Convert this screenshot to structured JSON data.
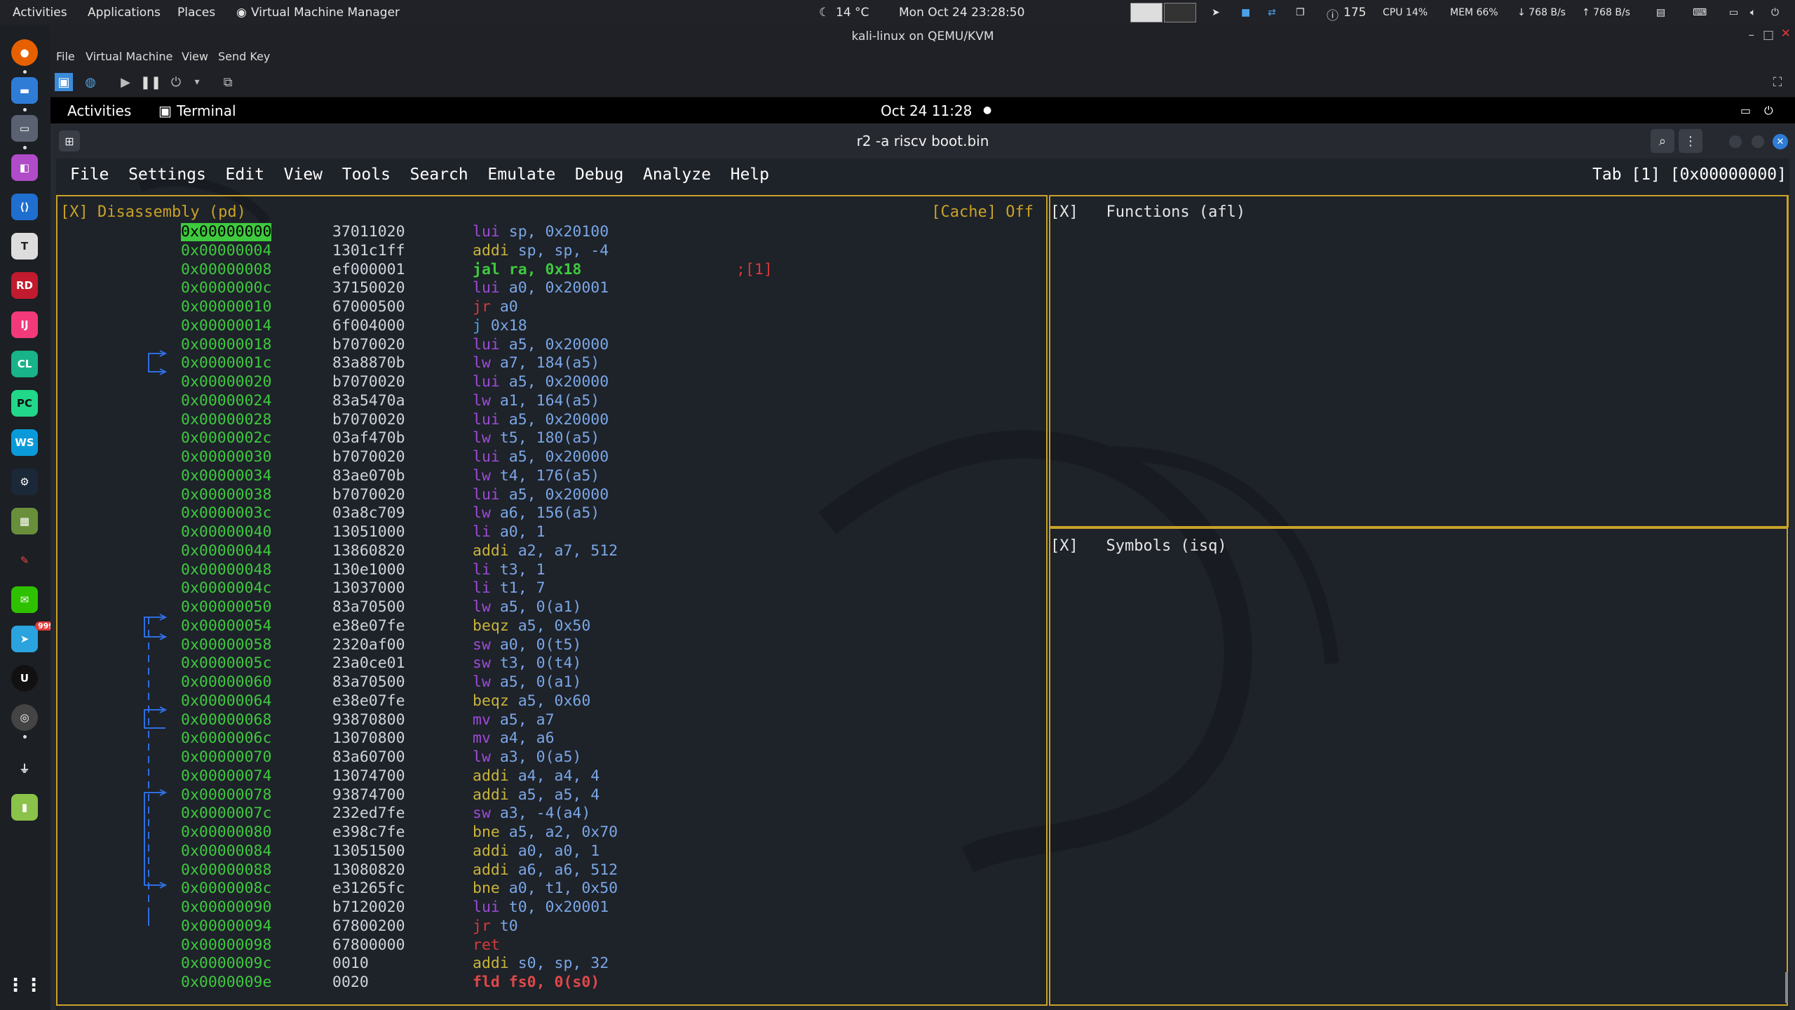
{
  "host_topbar": {
    "activities": "Activities",
    "applications": "Applications",
    "places": "Places",
    "app_name": "Virtual Machine Manager",
    "weather": "14 °C",
    "datetime": "Mon Oct 24  23:28:50",
    "count": "175",
    "cpu": "CPU 14%",
    "mem": "MEM 66%",
    "net_down": "↓ 768 B/s",
    "net_up": "↑ 768 B/s"
  },
  "vm_window": {
    "title": "kali-linux on QEMU/KVM",
    "menu": [
      "File",
      "Virtual Machine",
      "View",
      "Send Key"
    ]
  },
  "guest_topbar": {
    "activities": "Activities",
    "app": "Terminal",
    "clock": "Oct 24  11:28"
  },
  "terminal": {
    "title": "r2 -a riscv boot.bin",
    "menu_line": "File  Settings  Edit  View  Tools  Search  Emulate  Debug  Analyze  Help",
    "tab_info": "Tab [1] [0x00000000]"
  },
  "panels": {
    "disasm_title": "[X] Disassembly (pd)",
    "cache": "[Cache] Off",
    "functions_title": "[X]   Functions (afl)",
    "symbols_title": "[X]   Symbols (isq)"
  },
  "disasm": [
    {
      "addr": "0x00000000",
      "hex": "37011020",
      "mn": "lui",
      "ops": "sp, 0x20100",
      "cls": "mn-purple",
      "hl": true
    },
    {
      "addr": "0x00000004",
      "hex": "1301c1ff",
      "mn": "addi",
      "ops": "sp, sp, -4",
      "cls": "mn-yellow"
    },
    {
      "addr": "0x00000008",
      "hex": "ef000001",
      "mn": "jal",
      "ops": "ra, 0x18",
      "cls": "mn-green",
      "comment": ";[1]"
    },
    {
      "addr": "0x0000000c",
      "hex": "37150020",
      "mn": "lui",
      "ops": "a0, 0x20001",
      "cls": "mn-purple"
    },
    {
      "addr": "0x00000010",
      "hex": "67000500",
      "mn": "jr",
      "ops": "a0",
      "cls": "mn-red"
    },
    {
      "addr": "0x00000014",
      "hex": "6f004000",
      "mn": "j",
      "ops": "0x18",
      "cls": "mn-blue"
    },
    {
      "addr": "0x00000018",
      "hex": "b7070020",
      "mn": "lui",
      "ops": "a5, 0x20000",
      "cls": "mn-purple"
    },
    {
      "addr": "0x0000001c",
      "hex": "83a8870b",
      "mn": "lw",
      "ops": "a7, 184(a5)",
      "cls": "mn-purple"
    },
    {
      "addr": "0x00000020",
      "hex": "b7070020",
      "mn": "lui",
      "ops": "a5, 0x20000",
      "cls": "mn-purple"
    },
    {
      "addr": "0x00000024",
      "hex": "83a5470a",
      "mn": "lw",
      "ops": "a1, 164(a5)",
      "cls": "mn-purple"
    },
    {
      "addr": "0x00000028",
      "hex": "b7070020",
      "mn": "lui",
      "ops": "a5, 0x20000",
      "cls": "mn-purple"
    },
    {
      "addr": "0x0000002c",
      "hex": "03af470b",
      "mn": "lw",
      "ops": "t5, 180(a5)",
      "cls": "mn-purple"
    },
    {
      "addr": "0x00000030",
      "hex": "b7070020",
      "mn": "lui",
      "ops": "a5, 0x20000",
      "cls": "mn-purple"
    },
    {
      "addr": "0x00000034",
      "hex": "83ae070b",
      "mn": "lw",
      "ops": "t4, 176(a5)",
      "cls": "mn-purple"
    },
    {
      "addr": "0x00000038",
      "hex": "b7070020",
      "mn": "lui",
      "ops": "a5, 0x20000",
      "cls": "mn-purple"
    },
    {
      "addr": "0x0000003c",
      "hex": "03a8c709",
      "mn": "lw",
      "ops": "a6, 156(a5)",
      "cls": "mn-purple"
    },
    {
      "addr": "0x00000040",
      "hex": "13051000",
      "mn": "li",
      "ops": "a0, 1",
      "cls": "mn-purple"
    },
    {
      "addr": "0x00000044",
      "hex": "13860820",
      "mn": "addi",
      "ops": "a2, a7, 512",
      "cls": "mn-yellow"
    },
    {
      "addr": "0x00000048",
      "hex": "130e1000",
      "mn": "li",
      "ops": "t3, 1",
      "cls": "mn-purple"
    },
    {
      "addr": "0x0000004c",
      "hex": "13037000",
      "mn": "li",
      "ops": "t1, 7",
      "cls": "mn-purple"
    },
    {
      "addr": "0x00000050",
      "hex": "83a70500",
      "mn": "lw",
      "ops": "a5, 0(a1)",
      "cls": "mn-purple"
    },
    {
      "addr": "0x00000054",
      "hex": "e38e07fe",
      "mn": "beqz",
      "ops": "a5, 0x50",
      "cls": "mn-yellow"
    },
    {
      "addr": "0x00000058",
      "hex": "2320af00",
      "mn": "sw",
      "ops": "a0, 0(t5)",
      "cls": "mn-purple"
    },
    {
      "addr": "0x0000005c",
      "hex": "23a0ce01",
      "mn": "sw",
      "ops": "t3, 0(t4)",
      "cls": "mn-purple"
    },
    {
      "addr": "0x00000060",
      "hex": "83a70500",
      "mn": "lw",
      "ops": "a5, 0(a1)",
      "cls": "mn-purple"
    },
    {
      "addr": "0x00000064",
      "hex": "e38e07fe",
      "mn": "beqz",
      "ops": "a5, 0x60",
      "cls": "mn-yellow"
    },
    {
      "addr": "0x00000068",
      "hex": "93870800",
      "mn": "mv",
      "ops": "a5, a7",
      "cls": "mn-purple"
    },
    {
      "addr": "0x0000006c",
      "hex": "13070800",
      "mn": "mv",
      "ops": "a4, a6",
      "cls": "mn-purple"
    },
    {
      "addr": "0x00000070",
      "hex": "83a60700",
      "mn": "lw",
      "ops": "a3, 0(a5)",
      "cls": "mn-purple"
    },
    {
      "addr": "0x00000074",
      "hex": "13074700",
      "mn": "addi",
      "ops": "a4, a4, 4",
      "cls": "mn-yellow"
    },
    {
      "addr": "0x00000078",
      "hex": "93874700",
      "mn": "addi",
      "ops": "a5, a5, 4",
      "cls": "mn-yellow"
    },
    {
      "addr": "0x0000007c",
      "hex": "232ed7fe",
      "mn": "sw",
      "ops": "a3, -4(a4)",
      "cls": "mn-purple"
    },
    {
      "addr": "0x00000080",
      "hex": "e398c7fe",
      "mn": "bne",
      "ops": "a5, a2, 0x70",
      "cls": "mn-yellow"
    },
    {
      "addr": "0x00000084",
      "hex": "13051500",
      "mn": "addi",
      "ops": "a0, a0, 1",
      "cls": "mn-yellow"
    },
    {
      "addr": "0x00000088",
      "hex": "13080820",
      "mn": "addi",
      "ops": "a6, a6, 512",
      "cls": "mn-yellow"
    },
    {
      "addr": "0x0000008c",
      "hex": "e31265fc",
      "mn": "bne",
      "ops": "a0, t1, 0x50",
      "cls": "mn-yellow"
    },
    {
      "addr": "0x00000090",
      "hex": "b7120020",
      "mn": "lui",
      "ops": "t0, 0x20001",
      "cls": "mn-purple"
    },
    {
      "addr": "0x00000094",
      "hex": "67800200",
      "mn": "jr",
      "ops": "t0",
      "cls": "mn-red"
    },
    {
      "addr": "0x00000098",
      "hex": "67800000",
      "mn": "ret",
      "ops": "",
      "cls": "mn-red"
    },
    {
      "addr": "0x0000009c",
      "hex": "0010",
      "mn": "addi",
      "ops": "s0, sp, 32",
      "cls": "mn-yellow"
    },
    {
      "addr": "0x0000009e",
      "hex": "0020",
      "mn": "fld",
      "ops": "fs0, 0(s0)",
      "cls": "mn-redb"
    }
  ]
}
